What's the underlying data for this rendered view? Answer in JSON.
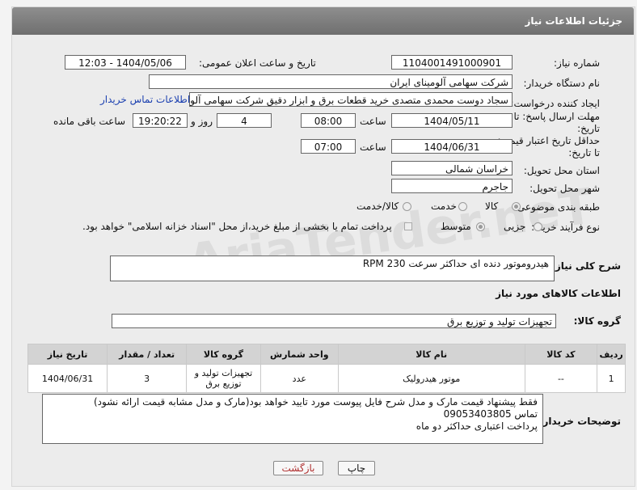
{
  "header": {
    "title": "جزئیات اطلاعات نیاز"
  },
  "fields": {
    "need_number": {
      "label": "شماره نیاز:",
      "value": "1104001491000901"
    },
    "announce_datetime": {
      "label": "تاریخ و ساعت اعلان عمومی:",
      "value": "1404/05/06 - 12:03"
    },
    "buyer_org": {
      "label": "نام دستگاه خریدار:",
      "value": "شرکت سهامی آلومینای ایران"
    },
    "requester": {
      "label": "ایجاد کننده درخواست:",
      "value": "سجاد دوست محمدی متصدی خرید قطعات برق و ابزار دقیق شرکت سهامی آلومینای ایران",
      "contact_link": "اطلاعات تماس خریدار"
    },
    "response_deadline": {
      "label": "مهلت ارسال پاسخ: تا تاریخ:",
      "date": "1404/05/11",
      "time_label": "ساعت",
      "time": "08:00",
      "days": "4",
      "days_label": "روز و",
      "remaining": "19:20:22",
      "remaining_label": "ساعت باقی مانده"
    },
    "price_validity": {
      "label": "حداقل تاریخ اعتبار قیمت: تا تاریخ:",
      "date": "1404/06/31",
      "time_label": "ساعت",
      "time": "07:00"
    },
    "province": {
      "label": "استان محل تحویل:",
      "value": "خراسان شمالی"
    },
    "city": {
      "label": "شهر محل تحویل:",
      "value": "جاجرم"
    },
    "category": {
      "label": "طبقه بندی موضوعی:",
      "options": [
        "کالا",
        "خدمت",
        "کالا/خدمت"
      ]
    },
    "purchase_type": {
      "label": "نوع فرآیند خرید :",
      "options": [
        "جزیی",
        "متوسط"
      ],
      "note": "پرداخت تمام یا بخشی از مبلغ خرید،از محل \"اسناد خزانه اسلامی\" خواهد بود."
    }
  },
  "description": {
    "label": "شرح کلی نیاز:",
    "value": "هیدروموتور دنده ای حداکثر سرعت 230 RPM"
  },
  "goods_section": {
    "title": "اطلاعات کالاهای مورد نیاز",
    "group_label": "گروه کالا:",
    "group_value": "تجهیزات تولید و توزیع برق"
  },
  "table": {
    "headers": [
      "ردیف",
      "کد کالا",
      "نام کالا",
      "واحد شمارش",
      "گروه کالا",
      "تعداد / مقدار",
      "تاریخ نیاز"
    ],
    "rows": [
      [
        "1",
        "--",
        "موتور هیدرولیک",
        "عدد",
        "تجهیزات تولید و توزیع برق",
        "3",
        "1404/06/31"
      ]
    ]
  },
  "buyer_notes": {
    "label": "توضیحات خریدار:",
    "value": "فقط پیشنهاد قیمت مارک و مدل شرح فایل پیوست مورد تایید خواهد بود(مارک و مدل مشابه قیمت ارائه نشود)\nتماس 09053403805\nپرداخت اعتباری حداکثر دو ماه"
  },
  "buttons": {
    "print": "چاپ",
    "back": "بازگشت"
  },
  "watermark": "AriaTender.neT"
}
